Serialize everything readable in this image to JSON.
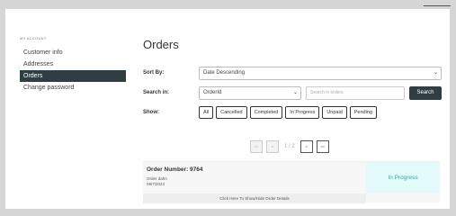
{
  "sidebar": {
    "heading": "MY ACCOUNT",
    "items": [
      {
        "label": "Customer info",
        "active": false
      },
      {
        "label": "Addresses",
        "active": false
      },
      {
        "label": "Orders",
        "active": true
      },
      {
        "label": "Change password",
        "active": false
      }
    ]
  },
  "main": {
    "title": "Orders",
    "sort": {
      "label": "Sort By:",
      "value": "Date Descending"
    },
    "search": {
      "label": "Search in:",
      "field_value": "OrderId",
      "placeholder": "Search in orders",
      "button_label": "Search"
    },
    "show": {
      "label": "Show:",
      "filters": [
        "All",
        "Cancelled",
        "Completed",
        "In Progress",
        "Unpaid",
        "Pending"
      ]
    },
    "pagination": {
      "first": "<<",
      "prev": "<",
      "info": "1 / 2",
      "next": ">",
      "last": ">>"
    },
    "order": {
      "number": "Order Number: 9764",
      "name": "Order dahn",
      "date": "09/7/2023",
      "status": "In Progress",
      "toggle": "Click Here To Show/Hide Order Details"
    }
  },
  "colors": {
    "dark": "#2e3e43",
    "status_bg": "#e3fafa",
    "status_text": "#2fa9a9"
  }
}
